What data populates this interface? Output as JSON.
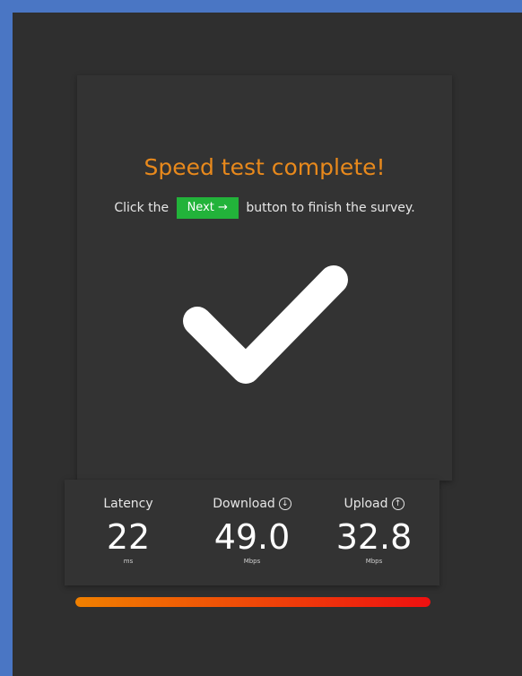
{
  "survey": {
    "title": "Speed test complete!",
    "message_before": "Click the",
    "next_chip_label": "Next →",
    "message_after": "button to finish the survey.",
    "check_icon": "checkmark-icon"
  },
  "stats": {
    "latency": {
      "label": "Latency",
      "value": "22",
      "unit": "ms"
    },
    "download": {
      "label": "Download",
      "value": "49.0",
      "unit": "Mbps",
      "icon": "download-icon",
      "icon_glyph": "↓"
    },
    "upload": {
      "label": "Upload",
      "value": "32.8",
      "unit": "Mbps",
      "icon": "upload-icon",
      "icon_glyph": "↑"
    }
  },
  "progress": {
    "fraction": 1.0,
    "color_start": "#f08000",
    "color_end": "#ee1010"
  },
  "colors": {
    "accent": "#e8891c",
    "next_chip": "#22b33a",
    "border": "#4a76c4"
  }
}
